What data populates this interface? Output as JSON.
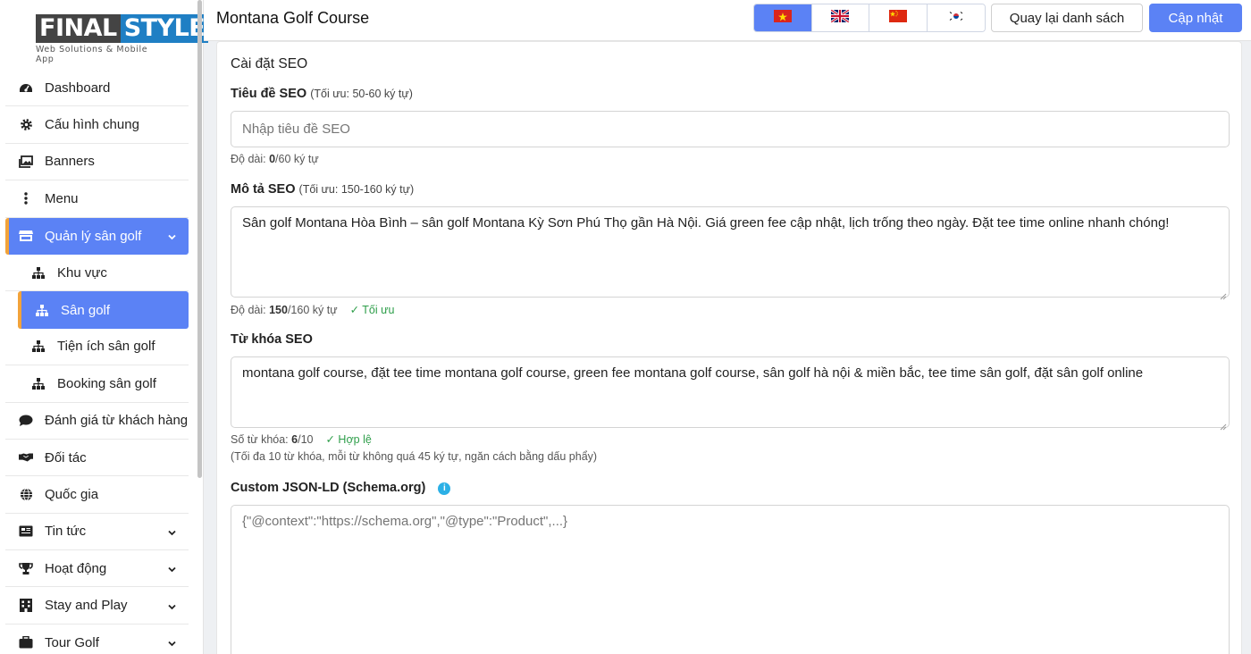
{
  "brand": {
    "name_part1": "FINAL",
    "name_part2": "STYLE",
    "tagline": "Web Solutions & Mobile App"
  },
  "sidebar": {
    "items": [
      {
        "label": "Dashboard",
        "icon": "gauge-icon"
      },
      {
        "label": "Cấu hình chung",
        "icon": "gear-icon"
      },
      {
        "label": "Banners",
        "icon": "images-icon"
      },
      {
        "label": "Menu",
        "icon": "dots-vertical-icon"
      },
      {
        "label": "Quản lý sân golf",
        "icon": "store-icon",
        "active": true,
        "expanded": true
      },
      {
        "label": "Khu vực",
        "icon": "sitemap-icon",
        "sub": true
      },
      {
        "label": "Sân golf",
        "icon": "sitemap-icon",
        "sub": true,
        "active": true
      },
      {
        "label": "Tiện ích sân golf",
        "icon": "sitemap-icon",
        "sub": true
      },
      {
        "label": "Booking sân golf",
        "icon": "sitemap-icon",
        "sub": true
      },
      {
        "label": "Đánh giá từ khách hàng",
        "icon": "comment-icon"
      },
      {
        "label": "Đối tác",
        "icon": "handshake-icon"
      },
      {
        "label": "Quốc gia",
        "icon": "globe-icon"
      },
      {
        "label": "Tin tức",
        "icon": "newspaper-icon",
        "has_children": true
      },
      {
        "label": "Hoạt động",
        "icon": "trophy-icon",
        "has_children": true
      },
      {
        "label": "Stay and Play",
        "icon": "building-icon",
        "has_children": true
      },
      {
        "label": "Tour Golf",
        "icon": "suitcase-icon",
        "has_children": true
      }
    ]
  },
  "header": {
    "title": "Montana Golf Course",
    "languages": [
      {
        "code": "vi",
        "icon": "flag-vietnam-icon",
        "active": true
      },
      {
        "code": "en",
        "icon": "flag-uk-icon"
      },
      {
        "code": "zh",
        "icon": "flag-china-icon"
      },
      {
        "code": "ko",
        "icon": "flag-korea-icon"
      }
    ],
    "back_label": "Quay lại danh sách",
    "save_label": "Cập nhật"
  },
  "seo": {
    "section_title": "Cài đặt SEO",
    "title_label": "Tiêu đề SEO",
    "title_hint": "(Tối ưu: 50-60 ký tự)",
    "title_placeholder": "Nhập tiêu đề SEO",
    "title_value": "",
    "title_len_prefix": "Độ dài: ",
    "title_len": "0",
    "title_len_suffix": "/60 ký tự",
    "desc_label": "Mô tả SEO",
    "desc_hint": "(Tối ưu: 150-160 ký tự)",
    "desc_value": "Sân golf Montana Hòa Bình – sân golf Montana Kỳ Sơn Phú Thọ gần Hà Nội. Giá green fee cập nhật, lịch trống theo ngày. Đặt tee time online nhanh chóng!",
    "desc_len_prefix": "Độ dài: ",
    "desc_len": "150",
    "desc_len_suffix": "/160 ký tự",
    "desc_status": "✓ Tối ưu",
    "kw_label": "Từ khóa SEO",
    "kw_value": "montana golf course, đặt tee time montana golf course, green fee montana golf course, sân golf hà nội & miền bắc, tee time sân golf, đặt sân golf online",
    "kw_count_prefix": "Số từ khóa: ",
    "kw_count": "6",
    "kw_count_suffix": "/10",
    "kw_status": "✓ Hợp lệ",
    "kw_note": "(Tối đa 10 từ khóa, mỗi từ không quá 45 ký tự, ngăn cách bằng dấu phẩy)",
    "jsonld_label": "Custom JSON-LD (Schema.org)",
    "jsonld_placeholder": "{\"@context\":\"https://schema.org\",\"@type\":\"Product\",...}"
  }
}
